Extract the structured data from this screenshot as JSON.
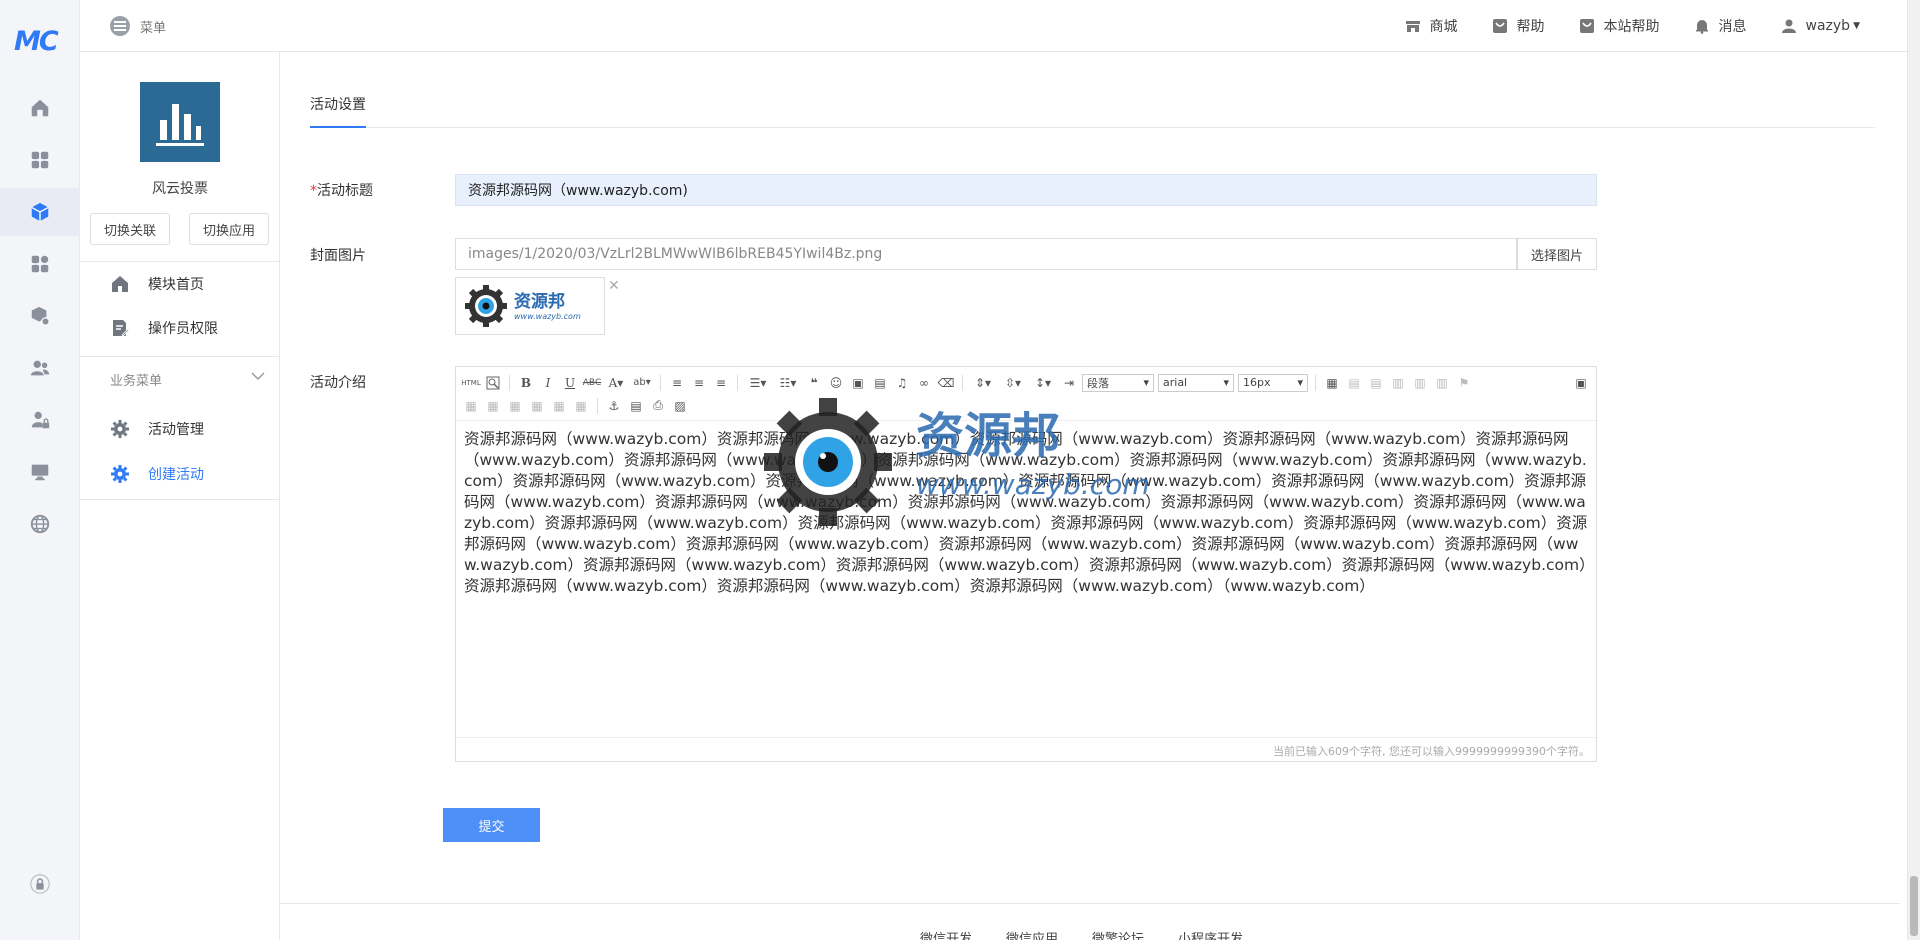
{
  "brand": {
    "logo_text": "MC"
  },
  "header": {
    "menu_label": "菜单",
    "links": [
      {
        "label": "商城",
        "icon": "shop-icon"
      },
      {
        "label": "帮助",
        "icon": "help-icon"
      },
      {
        "label": "本站帮助",
        "icon": "site-help-icon"
      },
      {
        "label": "消息",
        "icon": "bell-icon"
      },
      {
        "label": "wazyb",
        "icon": "user-icon"
      }
    ]
  },
  "rail": {
    "items": [
      "home-icon",
      "apps-icon",
      "module-icon",
      "plugin-icon",
      "package-icon",
      "users-icon",
      "user-lock-icon",
      "monitor-icon",
      "globe-icon"
    ],
    "active_index": 2,
    "bottom_icon": "lock-icon"
  },
  "sidebar": {
    "app_name": "风云投票",
    "btn_switch_link": "切换关联",
    "btn_switch_app": "切换应用",
    "items": [
      {
        "label": "模块首页"
      },
      {
        "label": "操作员权限"
      }
    ],
    "group_title": "业务菜单",
    "group_items": [
      {
        "label": "活动管理"
      },
      {
        "label": "创建活动"
      }
    ]
  },
  "main": {
    "tab": "活动设置",
    "title_label": "活动标题",
    "title_value": "资源邦源码网（www.wazyb.com)",
    "cover_label": "封面图片",
    "cover_path": "images/1/2020/03/VzLrl2BLMWwWIB6lbREB45YIwil4Bz.png",
    "pick_image": "选择图片",
    "thumb_text": "资源邦",
    "thumb_sub": "www.wazyb.com",
    "intro_label": "活动介绍",
    "editor_selects": {
      "paragraph": "段落",
      "font": "arial",
      "size": "16px"
    },
    "editor_text": "资源邦源码网（www.wazyb.com）资源邦源码网（www.wazyb.com）资源邦源码网（www.wazyb.com）资源邦源码网（www.wazyb.com）资源邦源码网（www.wazyb.com）资源邦源码网（www.wazyb.com）资源邦源码网（www.wazyb.com）资源邦源码网（www.wazyb.com）资源邦源码网（www.wazyb.com）资源邦源码网（www.wazyb.com）资源邦源码网（www.wazyb.com）资源邦源码网（www.wazyb.com）资源邦源码网（www.wazyb.com）资源邦源码网（www.wazyb.com）资源邦源码网（www.wazyb.com）资源邦源码网（www.wazyb.com）资源邦源码网（www.wazyb.com）资源邦源码网（www.wazyb.com）资源邦源码网（www.wazyb.com）资源邦源码网（www.wazyb.com）资源邦源码网（www.wazyb.com）资源邦源码网（www.wazyb.com）资源邦源码网（www.wazyb.com）资源邦源码网（www.wazyb.com）资源邦源码网（www.wazyb.com）资源邦源码网（www.wazyb.com）资源邦源码网（www.wazyb.com）资源邦源码网（www.wazyb.com）资源邦源码网（www.wazyb.com）资源邦源码网（www.wazyb.com）资源邦源码网（www.wazyb.com）资源邦源码网（www.wazyb.com）资源邦源码网（www.wazyb.com）资源邦源码网（www.wazyb.com）（www.wazyb.com）",
    "char_count": "当前已输入609个字符, 您还可以输入9999999999390个字符。",
    "submit": "提交"
  },
  "footer": {
    "links": [
      "微信开发",
      "微信应用",
      "微擎论坛",
      "小程序开发"
    ]
  },
  "watermark": {
    "text": "资源邦",
    "url": "www.wazyb.com"
  },
  "colors": {
    "accent": "#2f7bf5",
    "submit": "#4e8ef7",
    "app_icon_bg": "#2b6a94"
  }
}
